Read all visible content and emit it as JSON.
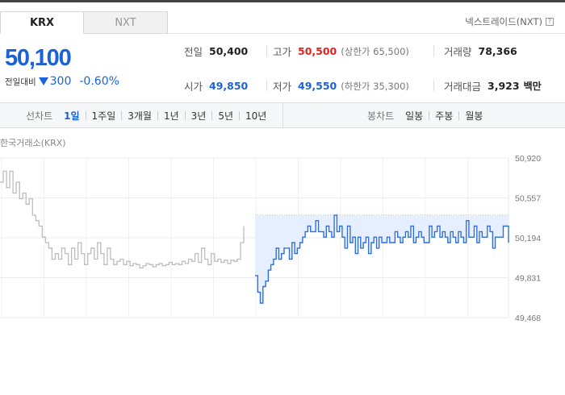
{
  "market_tabs": [
    {
      "label": "KRX",
      "active": true
    },
    {
      "label": "NXT",
      "active": false
    }
  ],
  "nxt_link": "넥스트레이드(NXT)",
  "price": {
    "current": "50,100",
    "change_label": "전일대비",
    "change": "300",
    "change_pct": "-0.60%",
    "direction": "down"
  },
  "info": {
    "prev_close": {
      "label": "전일",
      "value": "50,400"
    },
    "high": {
      "label": "고가",
      "value": "50,500",
      "limit_label": "(상한가 65,500)"
    },
    "volume": {
      "label": "거래량",
      "value": "78,366"
    },
    "open": {
      "label": "시가",
      "value": "49,850"
    },
    "low": {
      "label": "저가",
      "value": "49,550",
      "limit_label": "(하한가 35,300)"
    },
    "trade_value": {
      "label": "거래대금",
      "value": "3,923",
      "unit": "백만"
    }
  },
  "toolbar": {
    "line_chart_label": "선차트",
    "periods": [
      "1일",
      "1주일",
      "3개월",
      "1년",
      "3년",
      "5년",
      "10년"
    ],
    "active_period": "1일",
    "candle_label": "봉차트",
    "candle_periods": [
      "일봉",
      "주봉",
      "월봉"
    ]
  },
  "colors": {
    "blue": "#1c62d6",
    "red": "#e0231e",
    "line": "#2f6fe0",
    "fill": "#e6efff",
    "prev_line": "#bdbdbd"
  },
  "chart_data": {
    "type": "line",
    "title": "한국거래소(KRX)",
    "ylim": [
      49468,
      50920
    ],
    "y_ticks": [
      "50,920",
      "50,557",
      "50,194",
      "49,831",
      "49,468"
    ],
    "grid": true,
    "series": [
      {
        "values": [
          50700,
          50800,
          50650,
          50800,
          50600,
          50700,
          50550,
          50600,
          50500,
          50550,
          50400,
          50350,
          50300,
          50200,
          50150,
          50100,
          50000,
          50050,
          50000,
          50100,
          50050,
          49950,
          50100,
          50000,
          50150,
          50050,
          49950,
          50050,
          50100,
          50000,
          50150,
          50050,
          49950,
          50100,
          50000,
          49950,
          49980,
          50000,
          49950,
          49980,
          49940,
          49960,
          49950,
          49920,
          49940,
          49960,
          49950,
          49930,
          49950,
          49960,
          49940,
          49950,
          49970,
          49950,
          49960,
          49950,
          49980,
          49960,
          50000,
          49980,
          50050,
          49970,
          50100,
          50000,
          49950,
          50050,
          49980,
          50000,
          49970,
          49990,
          49960,
          49990,
          49980,
          50000,
          50150,
          50300
        ]
      },
      {
        "values": [
          49850,
          49700,
          49600,
          49750,
          49800,
          49900,
          49950,
          50000,
          50100,
          50000,
          50050,
          50100,
          50100,
          50000,
          50150,
          50050,
          50100,
          50150,
          50200,
          50250,
          50300,
          50250,
          50250,
          50350,
          50250,
          50250,
          50200,
          50300,
          50250,
          50200,
          50400,
          50250,
          50300,
          50200,
          50100,
          50300,
          50150,
          50200,
          50050,
          50200,
          50100,
          50150,
          50200,
          50050,
          50150,
          50200,
          50100,
          50200,
          50150,
          50150,
          50200,
          50150,
          50150,
          50250,
          50200,
          50150,
          50200,
          50250,
          50200,
          50300,
          50150,
          50200,
          50250,
          50200,
          50150,
          50150,
          50300,
          50200,
          50250,
          50300,
          50200,
          50250,
          50200,
          50150,
          50250,
          50200,
          50150,
          50250,
          50200,
          50150,
          50350,
          50200,
          50200,
          50300,
          50150,
          50250,
          50200,
          50200,
          50300,
          50250,
          50100,
          50200,
          50200,
          50200,
          50300,
          50300,
          50150
        ]
      }
    ]
  }
}
